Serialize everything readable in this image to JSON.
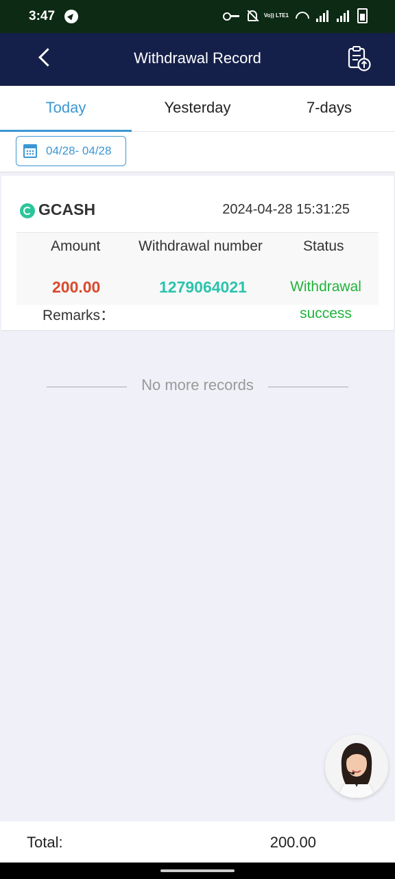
{
  "status_bar": {
    "time": "3:47",
    "volte": "Vo)) LTE1"
  },
  "header": {
    "title": "Withdrawal Record"
  },
  "tabs": [
    {
      "label": "Today",
      "active": true
    },
    {
      "label": "Yesterday",
      "active": false
    },
    {
      "label": "7-days",
      "active": false
    }
  ],
  "filter": {
    "date_range": "04/28- 04/28"
  },
  "record": {
    "method": "GCASH",
    "datetime": "2024-04-28 15:31:25",
    "headers": {
      "amount": "Amount",
      "number": "Withdrawal number",
      "status": "Status"
    },
    "amount": "200.00",
    "number": "1279064021",
    "status_line1": "Withdrawal",
    "status_line2": "success",
    "remarks_label": "Remarks："
  },
  "list_end": "No more records",
  "footer": {
    "total_label": "Total:",
    "total_value": "200.00"
  },
  "colors": {
    "accent": "#3b97d3",
    "header_bg": "#15204a",
    "amount": "#d9492c",
    "number": "#2bc3ad",
    "status": "#1fb33a"
  }
}
